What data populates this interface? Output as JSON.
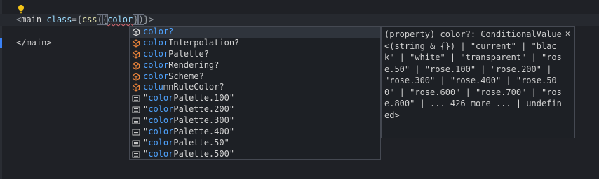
{
  "editor": {
    "line1": {
      "open": "<",
      "tag": "main",
      "space": " ",
      "attr": "class",
      "eq": "=",
      "b1": "{",
      "fn": "css",
      "p1": "(",
      "b2": "{",
      "word": "color",
      "b3": "}",
      "p2": ")",
      "b4": "}",
      "close": ">"
    },
    "line2": "</main>"
  },
  "suggestions": {
    "items": [
      {
        "match": "col",
        "rest": "or?",
        "icon": "property-icon-selected",
        "selected": true
      },
      {
        "match": "color",
        "rest": "Interpolation?",
        "icon": "property-icon"
      },
      {
        "match": "color",
        "rest": "Palette?",
        "icon": "property-icon"
      },
      {
        "match": "color",
        "rest": "Rendering?",
        "icon": "property-icon"
      },
      {
        "match": "color",
        "rest": "Scheme?",
        "icon": "property-icon"
      },
      {
        "match": "colu",
        "rest": "mnRuleColor?",
        "icon": "property-icon"
      },
      {
        "prefix": "\"",
        "match": "color",
        "rest": "Palette.100\"",
        "icon": "text-icon"
      },
      {
        "prefix": "\"",
        "match": "color",
        "rest": "Palette.200\"",
        "icon": "text-icon"
      },
      {
        "prefix": "\"",
        "match": "color",
        "rest": "Palette.300\"",
        "icon": "text-icon"
      },
      {
        "prefix": "\"",
        "match": "color",
        "rest": "Palette.400\"",
        "icon": "text-icon"
      },
      {
        "prefix": "\"",
        "match": "color",
        "rest": "Palette.50\"",
        "icon": "text-icon"
      },
      {
        "prefix": "\"",
        "match": "color",
        "rest": "Palette.500\"",
        "icon": "text-icon"
      }
    ]
  },
  "docs": {
    "lines": [
      "(property) color?: ConditionalValue",
      "<(string & {}) | \"current\" | \"blac",
      "k\" | \"white\" | \"transparent\" | \"ros",
      "e.50\" | \"rose.100\" | \"rose.200\" |",
      "\"rose.300\" | \"rose.400\" | \"rose.50",
      "0\" | \"rose.600\" | \"rose.700\" | \"ros",
      "e.800\" | ... 426 more ... | undefin",
      "ed>"
    ],
    "close": "×"
  },
  "colors": {
    "property_icon": "#e8833a",
    "property_icon_selected": "#d4d4d4",
    "match": "#4fa3ff",
    "accent": "#3b82f6"
  }
}
